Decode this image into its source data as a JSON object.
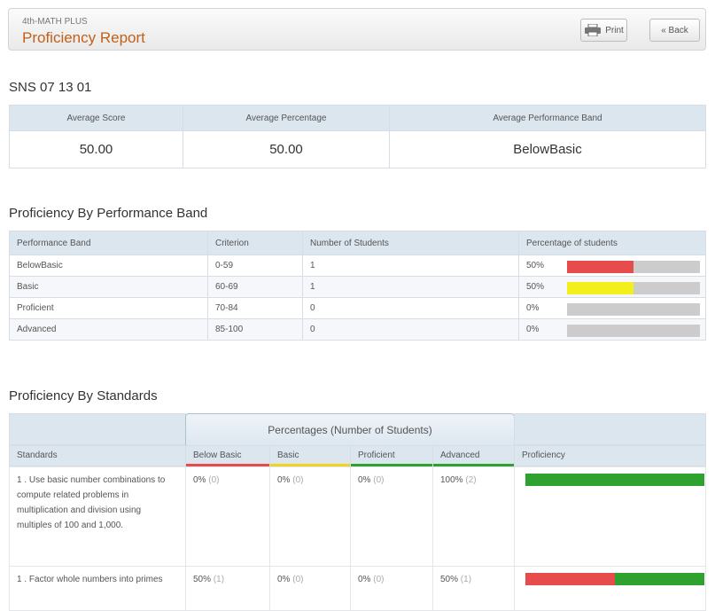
{
  "header": {
    "subtitle": "4th-MATH PLUS",
    "title": "Proficiency Report",
    "print_label": "Print",
    "back_label": "« Back"
  },
  "summary": {
    "code": "SNS 07 13 01",
    "headers": [
      "Average Score",
      "Average Percentage",
      "Average Performance Band"
    ],
    "values": [
      "50.00",
      "50.00",
      "BelowBasic"
    ]
  },
  "band_section": {
    "title": "Proficiency By Performance Band",
    "headers": [
      "Performance Band",
      "Criterion",
      "Number of Students",
      "Percentage of students"
    ],
    "rows": [
      {
        "band": "BelowBasic",
        "criterion": "0-59",
        "students": "1",
        "percent_label": "50%",
        "percent": 50,
        "color": "#e74c4c"
      },
      {
        "band": "Basic",
        "criterion": "60-69",
        "students": "1",
        "percent_label": "50%",
        "percent": 50,
        "color": "#f2ef1c"
      },
      {
        "band": "Proficient",
        "criterion": "70-84",
        "students": "0",
        "percent_label": "0%",
        "percent": 0,
        "color": "#2ea12e"
      },
      {
        "band": "Advanced",
        "criterion": "85-100",
        "students": "0",
        "percent_label": "0%",
        "percent": 0,
        "color": "#2ea12e"
      }
    ]
  },
  "standards_section": {
    "title": "Proficiency By Standards",
    "group_header": "Percentages (Number of Students)",
    "headers": {
      "standards": "Standards",
      "below_basic": "Below Basic",
      "basic": "Basic",
      "proficient": "Proficient",
      "advanced": "Advanced",
      "proficiency": "Proficiency"
    },
    "band_colors": {
      "below_basic": "#e74c4c",
      "basic": "#f2d21c",
      "proficient": "#2ea12e",
      "advanced": "#2ea12e"
    },
    "rows": [
      {
        "standard": "1 . Use basic number combinations to compute related problems in multiplication and division using multiples of 100 and 1,000.",
        "below_basic": {
          "pct": "0%",
          "count": "(0)"
        },
        "basic": {
          "pct": "0%",
          "count": "(0)"
        },
        "proficient": {
          "pct": "0%",
          "count": "(0)"
        },
        "advanced": {
          "pct": "100%",
          "count": "(2)"
        },
        "proficiency_split": [
          0,
          100
        ]
      },
      {
        "standard": "1 . Factor whole numbers into primes",
        "below_basic": {
          "pct": "50%",
          "count": "(1)"
        },
        "basic": {
          "pct": "0%",
          "count": "(0)"
        },
        "proficient": {
          "pct": "0%",
          "count": "(0)"
        },
        "advanced": {
          "pct": "50%",
          "count": "(1)"
        },
        "proficiency_split": [
          50,
          50
        ]
      }
    ]
  }
}
